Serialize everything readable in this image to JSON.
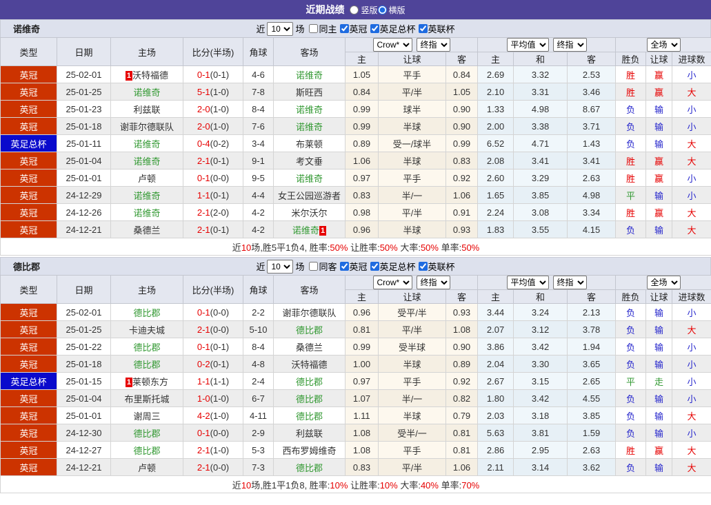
{
  "header": {
    "title": "近期战绩",
    "layout_options": [
      {
        "label": "竖版",
        "checked": false
      },
      {
        "label": "横版",
        "checked": true
      }
    ]
  },
  "colors": {
    "accent_purple": "#4f4499",
    "league_red": "#cc3300",
    "cup_blue": "#0a0acc",
    "team_green": "#339933",
    "score_red": "#e60000",
    "win_red": "#e60000",
    "lose_blue": "#2525cc",
    "draw_green": "#339933"
  },
  "table_head": {
    "type": "类型",
    "date": "日期",
    "home": "主场",
    "score": "比分(半场)",
    "corner": "角球",
    "away": "客场",
    "bookmaker": "Crow*",
    "final_odds": "终指",
    "average": "平均值",
    "final_odds2": "终指",
    "fulltime": "全场",
    "odds_home": "主",
    "odds_handicap": "让球",
    "odds_away": "客",
    "avg_home": "主",
    "avg_draw": "和",
    "avg_away": "客",
    "result_wl": "胜负",
    "result_handicap": "让球",
    "result_goals": "进球数"
  },
  "sections": [
    {
      "team": "诺维奇",
      "controls": {
        "near": "近",
        "count": "10",
        "unit": "场",
        "checks": [
          {
            "label": "同主",
            "checked": false
          },
          {
            "label": "英冠",
            "checked": true
          },
          {
            "label": "英足总杯",
            "checked": true
          },
          {
            "label": "英联杯",
            "checked": true
          }
        ]
      },
      "rows": [
        {
          "type": "英冠",
          "cup": false,
          "date": "25-02-01",
          "home": {
            "name": "沃特福德",
            "green": false,
            "badge": "1",
            "badge_side": "left"
          },
          "ft": "0-1",
          "ht": "(0-1)",
          "corner": "4-6",
          "away": {
            "name": "诺维奇",
            "green": true
          },
          "crow": [
            "1.05",
            "平手",
            "0.84"
          ],
          "avg": [
            "2.69",
            "3.32",
            "2.53"
          ],
          "res": [
            "胜",
            "赢",
            "小"
          ]
        },
        {
          "type": "英冠",
          "cup": false,
          "date": "25-01-25",
          "home": {
            "name": "诺维奇",
            "green": true
          },
          "ft": "5-1",
          "ht": "(1-0)",
          "corner": "7-8",
          "away": {
            "name": "斯旺西",
            "green": false
          },
          "crow": [
            "0.84",
            "平/半",
            "1.05"
          ],
          "avg": [
            "2.10",
            "3.31",
            "3.46"
          ],
          "res": [
            "胜",
            "赢",
            "大"
          ]
        },
        {
          "type": "英冠",
          "cup": false,
          "date": "25-01-23",
          "home": {
            "name": "利兹联",
            "green": false
          },
          "ft": "2-0",
          "ht": "(1-0)",
          "corner": "8-4",
          "away": {
            "name": "诺维奇",
            "green": true
          },
          "crow": [
            "0.99",
            "球半",
            "0.90"
          ],
          "avg": [
            "1.33",
            "4.98",
            "8.67"
          ],
          "res": [
            "负",
            "输",
            "小"
          ]
        },
        {
          "type": "英冠",
          "cup": false,
          "date": "25-01-18",
          "home": {
            "name": "谢菲尔德联队",
            "green": false
          },
          "ft": "2-0",
          "ht": "(1-0)",
          "corner": "7-6",
          "away": {
            "name": "诺维奇",
            "green": true
          },
          "crow": [
            "0.99",
            "半球",
            "0.90"
          ],
          "avg": [
            "2.00",
            "3.38",
            "3.71"
          ],
          "res": [
            "负",
            "输",
            "小"
          ]
        },
        {
          "type": "英足总杯",
          "cup": true,
          "date": "25-01-11",
          "home": {
            "name": "诺维奇",
            "green": true
          },
          "ft": "0-4",
          "ht": "(0-2)",
          "corner": "3-4",
          "away": {
            "name": "布莱顿",
            "green": false
          },
          "crow": [
            "0.89",
            "受一/球半",
            "0.99"
          ],
          "avg": [
            "6.52",
            "4.71",
            "1.43"
          ],
          "res": [
            "负",
            "输",
            "大"
          ]
        },
        {
          "type": "英冠",
          "cup": false,
          "date": "25-01-04",
          "home": {
            "name": "诺维奇",
            "green": true
          },
          "ft": "2-1",
          "ht": "(0-1)",
          "corner": "9-1",
          "away": {
            "name": "考文垂",
            "green": false
          },
          "crow": [
            "1.06",
            "半球",
            "0.83"
          ],
          "avg": [
            "2.08",
            "3.41",
            "3.41"
          ],
          "res": [
            "胜",
            "赢",
            "大"
          ]
        },
        {
          "type": "英冠",
          "cup": false,
          "date": "25-01-01",
          "home": {
            "name": "卢顿",
            "green": false
          },
          "ft": "0-1",
          "ht": "(0-0)",
          "corner": "9-5",
          "away": {
            "name": "诺维奇",
            "green": true
          },
          "crow": [
            "0.97",
            "平手",
            "0.92"
          ],
          "avg": [
            "2.60",
            "3.29",
            "2.63"
          ],
          "res": [
            "胜",
            "赢",
            "小"
          ]
        },
        {
          "type": "英冠",
          "cup": false,
          "date": "24-12-29",
          "home": {
            "name": "诺维奇",
            "green": true
          },
          "ft": "1-1",
          "ht": "(0-1)",
          "corner": "4-4",
          "away": {
            "name": "女王公园巡游者",
            "green": false
          },
          "crow": [
            "0.83",
            "半/一",
            "1.06"
          ],
          "avg": [
            "1.65",
            "3.85",
            "4.98"
          ],
          "res": [
            "平",
            "输",
            "小"
          ]
        },
        {
          "type": "英冠",
          "cup": false,
          "date": "24-12-26",
          "home": {
            "name": "诺维奇",
            "green": true
          },
          "ft": "2-1",
          "ht": "(2-0)",
          "corner": "4-2",
          "away": {
            "name": "米尔沃尔",
            "green": false
          },
          "crow": [
            "0.98",
            "平/半",
            "0.91"
          ],
          "avg": [
            "2.24",
            "3.08",
            "3.34"
          ],
          "res": [
            "胜",
            "赢",
            "大"
          ]
        },
        {
          "type": "英冠",
          "cup": false,
          "date": "24-12-21",
          "home": {
            "name": "桑德兰",
            "green": false
          },
          "ft": "2-1",
          "ht": "(0-1)",
          "corner": "4-2",
          "away": {
            "name": "诺维奇",
            "green": true,
            "badge": "1",
            "badge_side": "right"
          },
          "crow": [
            "0.96",
            "半球",
            "0.93"
          ],
          "avg": [
            "1.83",
            "3.55",
            "4.15"
          ],
          "res": [
            "负",
            "输",
            "大"
          ]
        }
      ],
      "summary": [
        {
          "t": "近",
          "r": false
        },
        {
          "t": "10",
          "r": true
        },
        {
          "t": "场,胜5平1负4, 胜率:",
          "r": false
        },
        {
          "t": "50%",
          "r": true
        },
        {
          "t": " 让胜率:",
          "r": false
        },
        {
          "t": "50%",
          "r": true
        },
        {
          "t": " 大率:",
          "r": false
        },
        {
          "t": "50%",
          "r": true
        },
        {
          "t": " 单率:",
          "r": false
        },
        {
          "t": "50%",
          "r": true
        }
      ]
    },
    {
      "team": "德比郡",
      "controls": {
        "near": "近",
        "count": "10",
        "unit": "场",
        "checks": [
          {
            "label": "同客",
            "checked": false
          },
          {
            "label": "英冠",
            "checked": true
          },
          {
            "label": "英足总杯",
            "checked": true
          },
          {
            "label": "英联杯",
            "checked": true
          }
        ]
      },
      "rows": [
        {
          "type": "英冠",
          "cup": false,
          "date": "25-02-01",
          "home": {
            "name": "德比郡",
            "green": true
          },
          "ft": "0-1",
          "ht": "(0-0)",
          "corner": "2-2",
          "away": {
            "name": "谢菲尔德联队",
            "green": false
          },
          "crow": [
            "0.96",
            "受平/半",
            "0.93"
          ],
          "avg": [
            "3.44",
            "3.24",
            "2.13"
          ],
          "res": [
            "负",
            "输",
            "小"
          ]
        },
        {
          "type": "英冠",
          "cup": false,
          "date": "25-01-25",
          "home": {
            "name": "卡迪夫城",
            "green": false
          },
          "ft": "2-1",
          "ht": "(0-0)",
          "corner": "5-10",
          "away": {
            "name": "德比郡",
            "green": true
          },
          "crow": [
            "0.81",
            "平/半",
            "1.08"
          ],
          "avg": [
            "2.07",
            "3.12",
            "3.78"
          ],
          "res": [
            "负",
            "输",
            "大"
          ]
        },
        {
          "type": "英冠",
          "cup": false,
          "date": "25-01-22",
          "home": {
            "name": "德比郡",
            "green": true
          },
          "ft": "0-1",
          "ht": "(0-1)",
          "corner": "8-4",
          "away": {
            "name": "桑德兰",
            "green": false
          },
          "crow": [
            "0.99",
            "受半球",
            "0.90"
          ],
          "avg": [
            "3.86",
            "3.42",
            "1.94"
          ],
          "res": [
            "负",
            "输",
            "小"
          ]
        },
        {
          "type": "英冠",
          "cup": false,
          "date": "25-01-18",
          "home": {
            "name": "德比郡",
            "green": true
          },
          "ft": "0-2",
          "ht": "(0-1)",
          "corner": "4-8",
          "away": {
            "name": "沃特福德",
            "green": false
          },
          "crow": [
            "1.00",
            "半球",
            "0.89"
          ],
          "avg": [
            "2.04",
            "3.30",
            "3.65"
          ],
          "res": [
            "负",
            "输",
            "小"
          ]
        },
        {
          "type": "英足总杯",
          "cup": true,
          "date": "25-01-15",
          "home": {
            "name": "莱顿东方",
            "green": false,
            "badge": "1",
            "badge_side": "left"
          },
          "ft": "1-1",
          "ht": "(1-1)",
          "corner": "2-4",
          "away": {
            "name": "德比郡",
            "green": true
          },
          "crow": [
            "0.97",
            "平手",
            "0.92"
          ],
          "avg": [
            "2.67",
            "3.15",
            "2.65"
          ],
          "res": [
            "平",
            "走",
            "小"
          ]
        },
        {
          "type": "英冠",
          "cup": false,
          "date": "25-01-04",
          "home": {
            "name": "布里斯托城",
            "green": false
          },
          "ft": "1-0",
          "ht": "(1-0)",
          "corner": "6-7",
          "away": {
            "name": "德比郡",
            "green": true
          },
          "crow": [
            "1.07",
            "半/一",
            "0.82"
          ],
          "avg": [
            "1.80",
            "3.42",
            "4.55"
          ],
          "res": [
            "负",
            "输",
            "小"
          ]
        },
        {
          "type": "英冠",
          "cup": false,
          "date": "25-01-01",
          "home": {
            "name": "谢周三",
            "green": false
          },
          "ft": "4-2",
          "ht": "(1-0)",
          "corner": "4-11",
          "away": {
            "name": "德比郡",
            "green": true
          },
          "crow": [
            "1.11",
            "半球",
            "0.79"
          ],
          "avg": [
            "2.03",
            "3.18",
            "3.85"
          ],
          "res": [
            "负",
            "输",
            "大"
          ]
        },
        {
          "type": "英冠",
          "cup": false,
          "date": "24-12-30",
          "home": {
            "name": "德比郡",
            "green": true
          },
          "ft": "0-1",
          "ht": "(0-0)",
          "corner": "2-9",
          "away": {
            "name": "利兹联",
            "green": false
          },
          "crow": [
            "1.08",
            "受半/一",
            "0.81"
          ],
          "avg": [
            "5.63",
            "3.81",
            "1.59"
          ],
          "res": [
            "负",
            "输",
            "小"
          ]
        },
        {
          "type": "英冠",
          "cup": false,
          "date": "24-12-27",
          "home": {
            "name": "德比郡",
            "green": true
          },
          "ft": "2-1",
          "ht": "(1-0)",
          "corner": "5-3",
          "away": {
            "name": "西布罗姆维奇",
            "green": false
          },
          "crow": [
            "1.08",
            "平手",
            "0.81"
          ],
          "avg": [
            "2.86",
            "2.95",
            "2.63"
          ],
          "res": [
            "胜",
            "赢",
            "大"
          ]
        },
        {
          "type": "英冠",
          "cup": false,
          "date": "24-12-21",
          "home": {
            "name": "卢顿",
            "green": false
          },
          "ft": "2-1",
          "ht": "(0-0)",
          "corner": "7-3",
          "away": {
            "name": "德比郡",
            "green": true
          },
          "crow": [
            "0.83",
            "平/半",
            "1.06"
          ],
          "avg": [
            "2.11",
            "3.14",
            "3.62"
          ],
          "res": [
            "负",
            "输",
            "大"
          ]
        }
      ],
      "summary": [
        {
          "t": "近",
          "r": false
        },
        {
          "t": "10",
          "r": true
        },
        {
          "t": "场,胜1平1负8, 胜率:",
          "r": false
        },
        {
          "t": "10%",
          "r": true
        },
        {
          "t": " 让胜率:",
          "r": false
        },
        {
          "t": "10%",
          "r": true
        },
        {
          "t": " 大率:",
          "r": false
        },
        {
          "t": "40%",
          "r": true
        },
        {
          "t": " 单率:",
          "r": false
        },
        {
          "t": "70%",
          "r": true
        }
      ]
    }
  ]
}
